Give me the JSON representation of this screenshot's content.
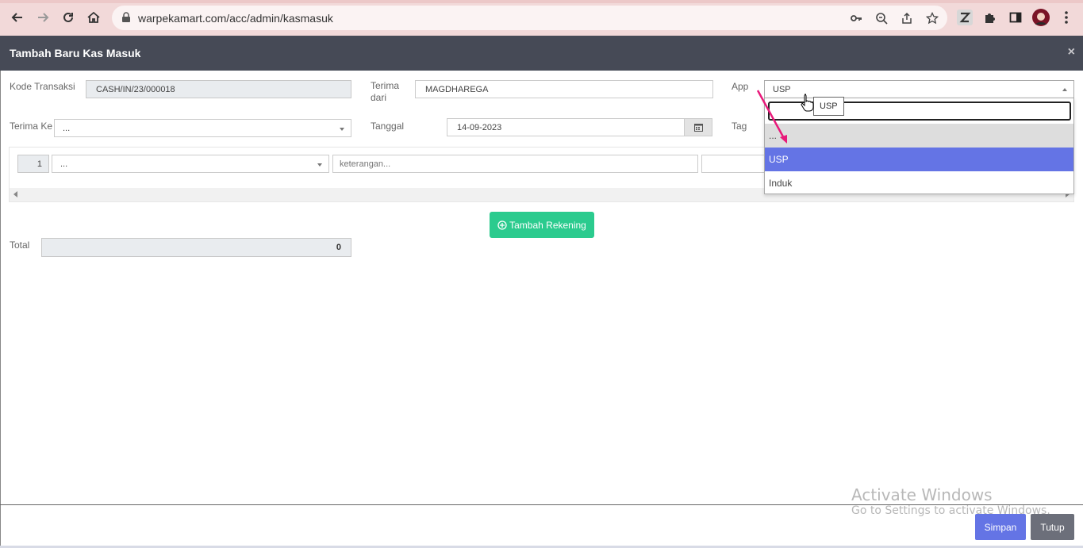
{
  "browser": {
    "url": "warpekamart.com/acc/admin/kasmasuk"
  },
  "modal": {
    "title": "Tambah Baru Kas Masuk",
    "close_glyph": "×"
  },
  "form": {
    "kode_transaksi_label": "Kode Transaksi",
    "kode_transaksi_value": "CASH/IN/23/000018",
    "terima_dari_label_1": "Terima",
    "terima_dari_label_2": "dari",
    "terima_dari_value": "MAGDHAREGA",
    "app_label": "App",
    "app_value": "USP",
    "terima_ke_label": "Terima Ke",
    "terima_ke_value": "...",
    "tanggal_label": "Tanggal",
    "tanggal_value": "14-09-2023",
    "tag_label": "Tag",
    "total_label": "Total",
    "total_value": "0"
  },
  "detail_row": {
    "number": "1",
    "account_value": "...",
    "keterangan_placeholder": "keterangan..."
  },
  "buttons": {
    "tambah_rekening": "Tambah Rekening",
    "simpan": "Simpan",
    "tutup": "Tutup"
  },
  "app_dropdown": {
    "tooltip": "USP",
    "options": [
      "...",
      "USP",
      "Induk"
    ],
    "selected": "USP",
    "highlight_color": "#6474e5"
  },
  "watermark": {
    "line1": "Activate Windows",
    "line2": "Go to Settings to activate Windows."
  },
  "colors": {
    "header_bg": "#464a56",
    "add_button": "#2bcb8e",
    "save_button": "#6474e5",
    "close_button": "#6c6f7a",
    "annotation_arrow": "#e8197a"
  }
}
